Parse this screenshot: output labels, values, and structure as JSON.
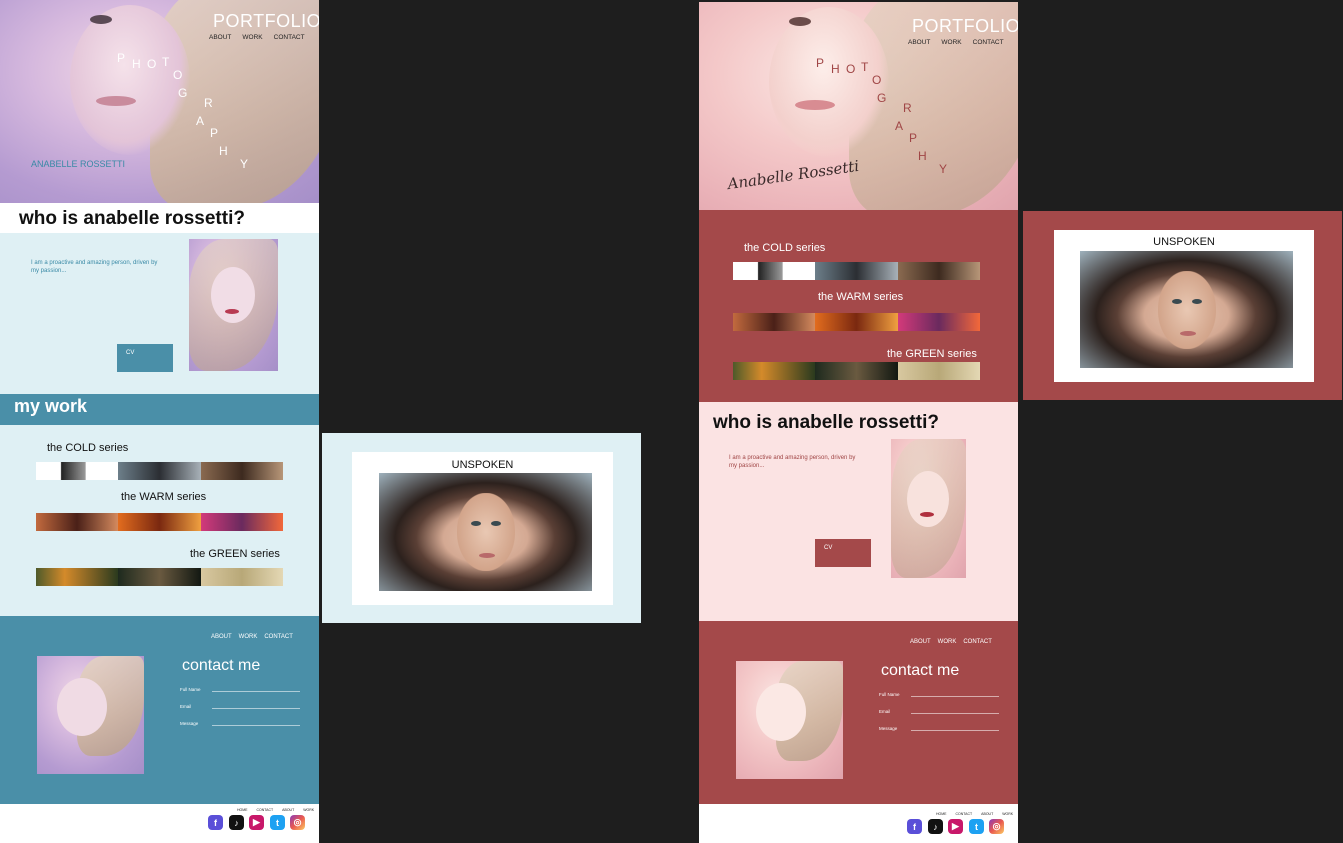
{
  "brand": {
    "title": "PORTFOLIO",
    "name": "ANABELLE ROSSETTI",
    "signature": "Anabelle Rossetti"
  },
  "nav": {
    "about": "ABOUT",
    "work": "WORK",
    "contact": "CONTACT"
  },
  "photography_letters": [
    "P",
    "H",
    "O",
    "T",
    "O",
    "G",
    "R",
    "A",
    "P",
    "H",
    "Y"
  ],
  "about": {
    "heading": "who is anabelle rossetti?",
    "intro": "I am a proactive and amazing person, driven by my passion...",
    "cv_label": "CV"
  },
  "work": {
    "heading": "my work",
    "series": [
      "the COLD series",
      "the WARM series",
      "the GREEN series"
    ]
  },
  "contact": {
    "heading": "contact me",
    "fields": [
      "Full Name",
      "Email",
      "Message"
    ]
  },
  "footer": {
    "links": [
      "HOME",
      "CONTACT",
      "ABOUT",
      "WORK"
    ]
  },
  "social_icons": [
    "facebook-icon",
    "tiktok-icon",
    "youtube-icon",
    "twitter-icon",
    "instagram-icon"
  ],
  "detail": {
    "title": "UNSPOKEN"
  },
  "colors": {
    "cold_light": "#dff0f4",
    "cold_accent": "#4a8fa8",
    "cold_text": "#3a8aa6",
    "warm_light": "#fbe3e3",
    "warm_accent": "#a4494a",
    "warm_text": "#a04646",
    "canvas": "#1e1e1e"
  }
}
